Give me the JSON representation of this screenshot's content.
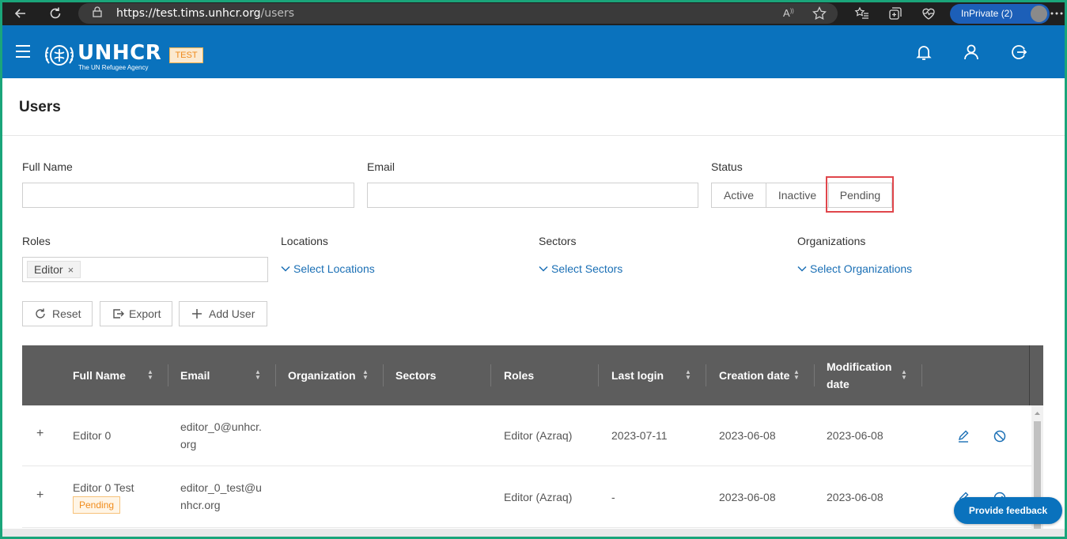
{
  "browser": {
    "url_host": "https://test.tims.unhcr.org",
    "url_path": "/users",
    "inprivate_label": "InPrivate (2)"
  },
  "header": {
    "brand": "UNHCR",
    "brand_sub": "The UN Refugee Agency",
    "env_badge": "TEST",
    "brand_color": "#0a72bd"
  },
  "page": {
    "title": "Users"
  },
  "filters": {
    "full_name_label": "Full Name",
    "full_name_value": "",
    "email_label": "Email",
    "email_value": "",
    "status_label": "Status",
    "status_options": [
      "Active",
      "Inactive",
      "Pending"
    ],
    "roles_label": "Roles",
    "roles_selected": [
      "Editor"
    ],
    "locations_label": "Locations",
    "locations_placeholder": "Select Locations",
    "sectors_label": "Sectors",
    "sectors_placeholder": "Select Sectors",
    "organizations_label": "Organizations",
    "organizations_placeholder": "Select Organizations"
  },
  "actions": {
    "reset": "Reset",
    "export": "Export",
    "add_user": "Add User"
  },
  "table": {
    "columns": [
      "Full Name",
      "Email",
      "Organization",
      "Sectors",
      "Roles",
      "Last login",
      "Creation date",
      "Modification date"
    ],
    "rows": [
      {
        "expand": "+",
        "full_name": "Editor 0",
        "badge": "",
        "email_l1": "editor_0@unhcr.",
        "email_l2": "org",
        "organization": "",
        "sectors": "",
        "roles": "Editor (Azraq)",
        "last_login": "2023-07-11",
        "created": "2023-06-08",
        "modified": "2023-06-08"
      },
      {
        "expand": "+",
        "full_name": "Editor 0 Test",
        "badge": "Pending",
        "email_l1": "editor_0_test@u",
        "email_l2": "nhcr.org",
        "organization": "",
        "sectors": "",
        "roles": "Editor (Azraq)",
        "last_login": "-",
        "created": "2023-06-08",
        "modified": "2023-06-08"
      }
    ]
  },
  "feedback": {
    "label": "Provide feedback"
  }
}
